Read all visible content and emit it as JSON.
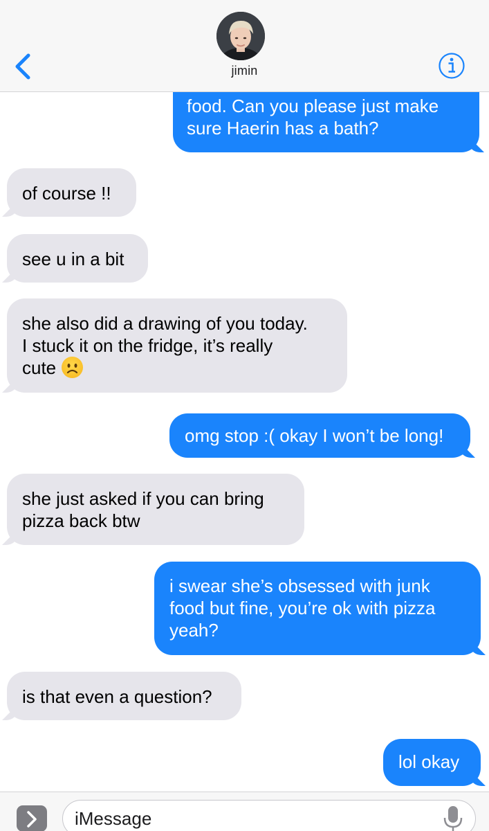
{
  "header": {
    "contact_name": "jimin",
    "back_icon": "chevron-left-icon",
    "info_icon": "info-circle-icon",
    "accent_color": "#1a84fc"
  },
  "messages": [
    {
      "direction": "outgoing",
      "text": "food. Can you please just make\nsure Haerin has a bath?"
    },
    {
      "direction": "incoming",
      "text": "of course !!"
    },
    {
      "direction": "incoming",
      "text": "see u in a bit"
    },
    {
      "direction": "incoming",
      "text": "she also did a drawing of you today.\nI stuck it on the fridge, it’s really\ncute",
      "emoji": "frowning-face"
    },
    {
      "direction": "outgoing",
      "text": "omg stop :( okay I won’t be long!"
    },
    {
      "direction": "incoming",
      "text": "she just asked if you can bring\npizza back btw"
    },
    {
      "direction": "outgoing",
      "text": "i swear she’s obsessed with junk\nfood but fine, you’re ok with pizza\nyeah?"
    },
    {
      "direction": "incoming",
      "text": "is that even a question?"
    },
    {
      "direction": "outgoing",
      "text": "lol okay"
    }
  ],
  "colors": {
    "outgoing_bubble": "#1a84fc",
    "incoming_bubble": "#e6e5eb"
  },
  "input": {
    "placeholder": "iMessage",
    "apps_icon": "chevron-right-icon",
    "mic_icon": "microphone-icon"
  }
}
